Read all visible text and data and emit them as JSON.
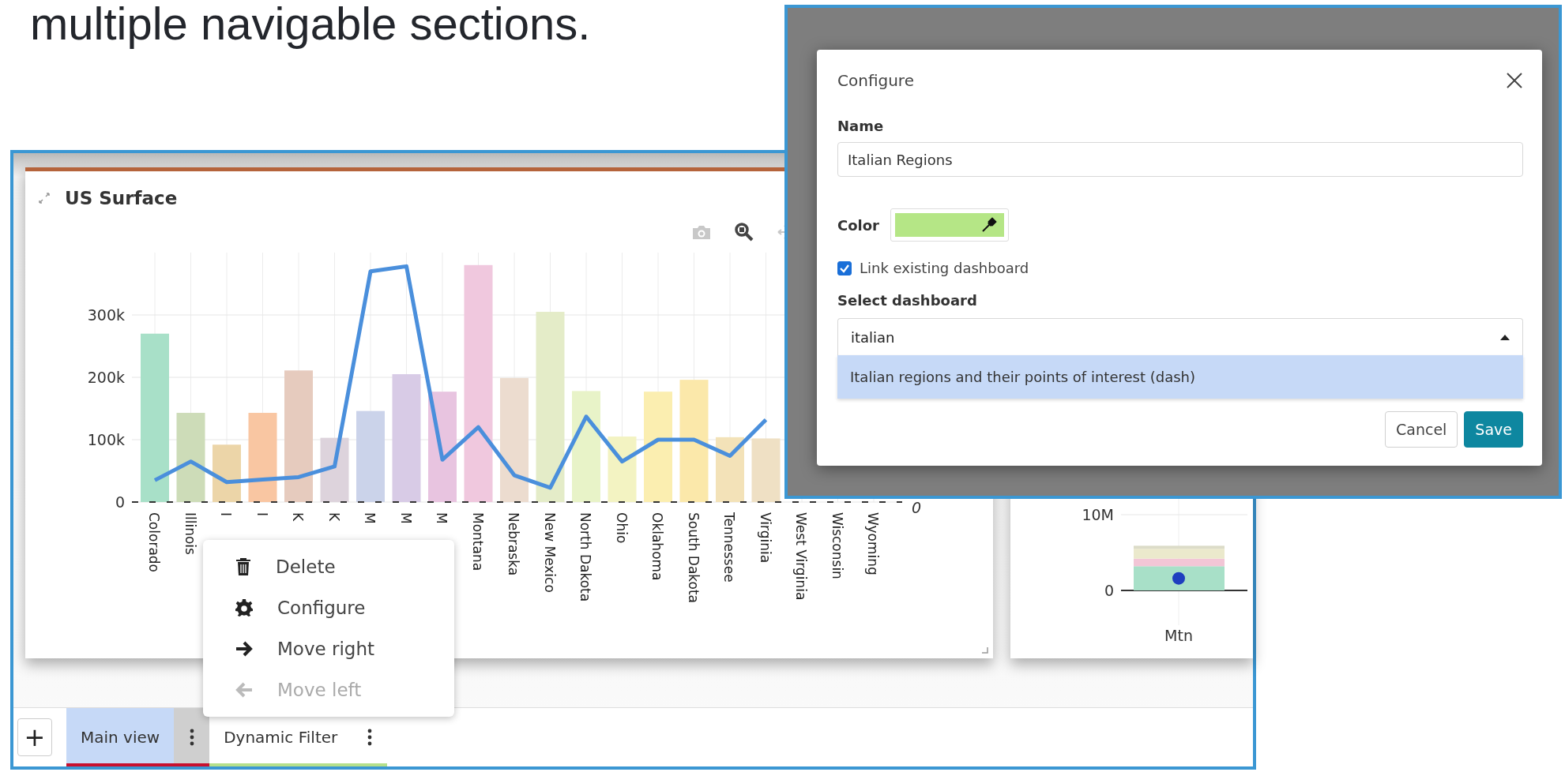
{
  "heading": "multiple navigable sections.",
  "chart_panel": {
    "title": "US Surface",
    "chart_data": {
      "type": "bar",
      "categories": [
        "Colorado",
        "Illinois",
        "I",
        "I",
        "K",
        "K",
        "M",
        "M",
        "M",
        "Montana",
        "Nebraska",
        "New Mexico",
        "North Dakota",
        "Ohio",
        "Oklahoma",
        "South Dakota",
        "Tennessee",
        "Virginia",
        "West Virginia",
        "Wisconsin",
        "Wyoming"
      ],
      "series": [
        {
          "type": "bar",
          "colors": [
            "#a8e0c8",
            "#cddcb8",
            "#ecd5a8",
            "#f9c6a2",
            "#e6cbbe",
            "#ddd3dc",
            "#cbd3ea",
            "#d8cbe6",
            "#e8c4e0",
            "#f0c8de",
            "#ecdccf",
            "#e4ecc8",
            "#e8f3c8",
            "#f3f3c2",
            "#fbeeb0",
            "#fbe8aa",
            "#f3e2b8",
            "#efe0c4",
            null,
            null,
            null
          ],
          "values": [
            270000,
            143000,
            92000,
            143000,
            211000,
            103000,
            146000,
            205000,
            177000,
            380000,
            199000,
            305000,
            178000,
            105000,
            177000,
            196000,
            104000,
            102000,
            null,
            null,
            null
          ]
        },
        {
          "type": "line",
          "color": "#4a8fdc",
          "values": [
            35000,
            65000,
            32000,
            36000,
            40000,
            57000,
            370000,
            378000,
            68000,
            120000,
            43000,
            23000,
            137000,
            65000,
            100000,
            100000,
            74000,
            132000,
            null,
            null,
            null
          ]
        }
      ],
      "grid": true,
      "ylim": [
        0,
        400000
      ],
      "yticks": [
        {
          "value": 0,
          "label": "0"
        },
        {
          "value": 100000,
          "label": "100k"
        },
        {
          "value": 200000,
          "label": "200k"
        },
        {
          "value": 300000,
          "label": "300k"
        }
      ]
    },
    "secondary_axis_label": "0"
  },
  "side_panel": {
    "chart_data": {
      "type": "bar",
      "stacked": true,
      "categories": [
        "Mtn"
      ],
      "series": [
        {
          "type": "bar",
          "color": "#a8e0c8",
          "values": [
            3200000
          ]
        },
        {
          "type": "bar",
          "color": "#f2c6d6",
          "values": [
            1000000
          ]
        },
        {
          "type": "bar",
          "color": "#ebe9cc",
          "values": [
            1300000
          ]
        },
        {
          "type": "bar",
          "color": "#dcdcc8",
          "values": [
            400000
          ]
        },
        {
          "type": "scatter",
          "color": "#1f3fbf",
          "values": [
            1600000
          ]
        }
      ],
      "ylim": [
        0,
        10000000
      ],
      "yticks": [
        {
          "value": 0,
          "label": "0"
        },
        {
          "value": 10000000,
          "label": "10M"
        }
      ]
    }
  },
  "context_menu": [
    {
      "label": "Delete",
      "disabled": false
    },
    {
      "label": "Configure",
      "disabled": false
    },
    {
      "label": "Move right",
      "disabled": false
    },
    {
      "label": "Move left",
      "disabled": true
    }
  ],
  "tab_bar": {
    "add_button": "+",
    "tabs": [
      {
        "label": "Main view",
        "selected": true,
        "color": "#c8102e"
      },
      {
        "label": "Dynamic Filter",
        "selected": false,
        "color": "#b5e08a"
      }
    ]
  },
  "dialog": {
    "title": "Configure",
    "name_label": "Name",
    "name_value": "Italian Regions",
    "color_label": "Color",
    "color_picker": {
      "color": "#b5e686"
    },
    "link_checkbox": {
      "label": "Link existing dashboard",
      "checked": true
    },
    "select_label": "Select dashboard",
    "select_value": "italian",
    "options": [
      {
        "label": "Italian regions and their points of interest (dash)",
        "selected": true
      }
    ],
    "buttons": [
      {
        "label": "Cancel",
        "kind": "secondary"
      },
      {
        "label": "Save",
        "kind": "primary"
      }
    ]
  }
}
